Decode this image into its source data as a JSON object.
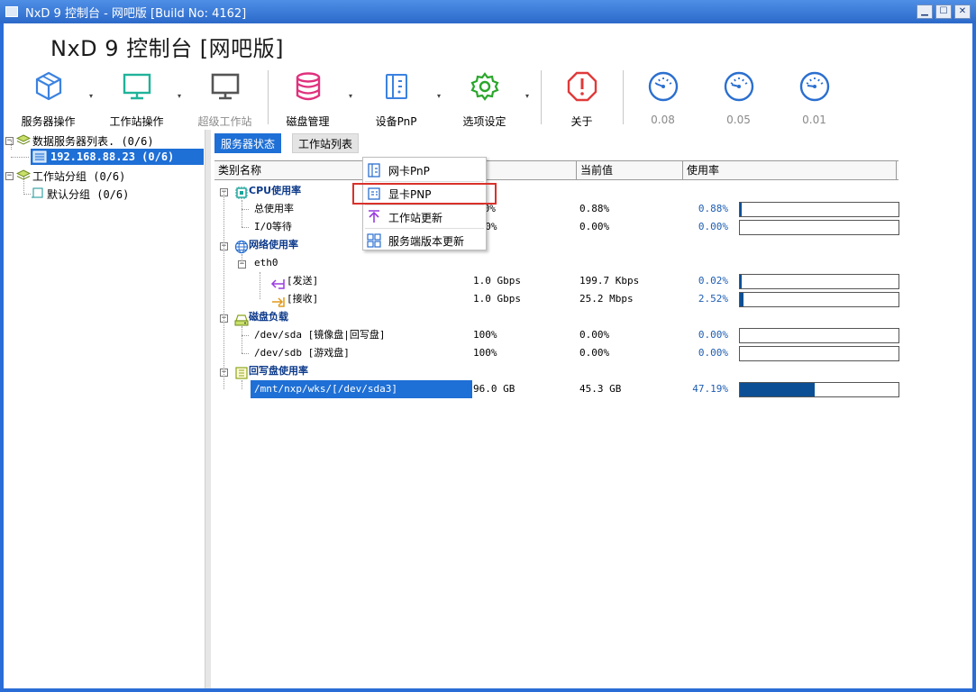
{
  "window": {
    "title": "NxD 9 控制台 - 网吧版 [Build No: 4162]",
    "min": "▁",
    "max": "☐",
    "close": "✕"
  },
  "app_heading": "NxD 9 控制台 [网吧版]",
  "toolbar": {
    "server_ops": "服务器操作",
    "ws_ops": "工作站操作",
    "super_ws": "超级工作站",
    "disk_mgmt": "磁盘管理",
    "device_pnp": "设备PnP",
    "options": "选项设定",
    "about": "关于",
    "gauge1": "0.08",
    "gauge2": "0.05",
    "gauge3": "0.01",
    "dropdown_arrow": "▾"
  },
  "tree": {
    "root1": "数据服务器列表. (0/6)",
    "server1": "192.168.88.23 (0/6)",
    "root2": "工作站分组 (0/6)",
    "group1": "默认分组 (0/6)"
  },
  "tabs": {
    "server_status": "服务器状态",
    "ws_list": "工作站列表"
  },
  "columns": {
    "category": "类别名称",
    "max": "大值",
    "current": "当前值",
    "usage": "使用率"
  },
  "rows": {
    "cpu_title": "CPU使用率",
    "cpu_total": "总使用率",
    "cpu_total_max": "00%",
    "cpu_total_cur": "0.88%",
    "cpu_total_pct": "0.88%",
    "cpu_io": "I/O等待",
    "cpu_io_max": "100%",
    "cpu_io_cur": "0.00%",
    "cpu_io_pct": "0.00%",
    "net_title": "网络使用率",
    "eth0": "eth0",
    "send": "[发送]",
    "send_max": "1.0 Gbps",
    "send_cur": "199.7 Kbps",
    "send_pct": "0.02%",
    "recv": "[接收]",
    "recv_max": "1.0 Gbps",
    "recv_cur": "25.2 Mbps",
    "recv_pct": "2.52%",
    "disk_title": "磁盘负载",
    "sda": "/dev/sda [镜像盘|回写盘]",
    "sda_max": "100%",
    "sda_cur": "0.00%",
    "sda_pct": "0.00%",
    "sdb": "/dev/sdb [游戏盘]",
    "sdb_max": "100%",
    "sdb_cur": "0.00%",
    "sdb_pct": "0.00%",
    "wb_title": "回写盘使用率",
    "wb_path": "/mnt/nxp/wks/[/dev/sda3]",
    "wb_max": "96.0 GB",
    "wb_cur": "45.3 GB",
    "wb_pct": "47.19%"
  },
  "bars": {
    "cpu_total": 0.0088,
    "cpu_io": 0,
    "send": 0.0002,
    "recv": 0.0252,
    "sda": 0,
    "sdb": 0,
    "wb": 0.4719
  },
  "context_menu": {
    "nic_pnp": "网卡PnP",
    "gpu_pnp": "显卡PNP",
    "ws_update": "工作站更新",
    "server_update": "服务端版本更新"
  }
}
